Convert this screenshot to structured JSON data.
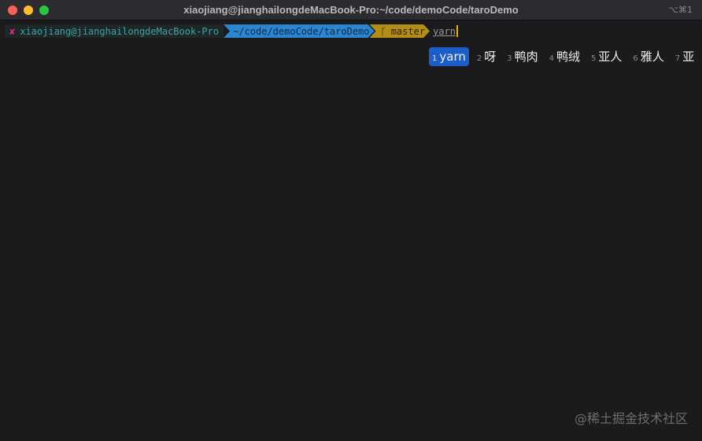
{
  "window": {
    "title": "xiaojiang@jianghailongdeMacBook-Pro:~/code/demoCode/taroDemo",
    "shortcut": "⌥⌘1"
  },
  "prompt": {
    "status": "✘",
    "user_host": "xiaojiang@jianghailongdeMacBook-Pro",
    "path": "~/code/demoCode/taroDemo",
    "branch_icon": "",
    "branch": "master",
    "command": "yarn"
  },
  "ime": {
    "candidates": [
      {
        "n": "1",
        "text": "yarn"
      },
      {
        "n": "2",
        "text": "呀"
      },
      {
        "n": "3",
        "text": "鸭肉"
      },
      {
        "n": "4",
        "text": "鸭绒"
      },
      {
        "n": "5",
        "text": "亚人"
      },
      {
        "n": "6",
        "text": "雅人"
      },
      {
        "n": "7",
        "text": "亚"
      }
    ],
    "selected": 0
  },
  "watermark": "@稀土掘金技术社区",
  "colors": {
    "bg": "#1b1b1d",
    "path_segment": "#2a86d1",
    "branch_segment": "#b28e17",
    "selected_candidate": "#1a5fc9"
  }
}
